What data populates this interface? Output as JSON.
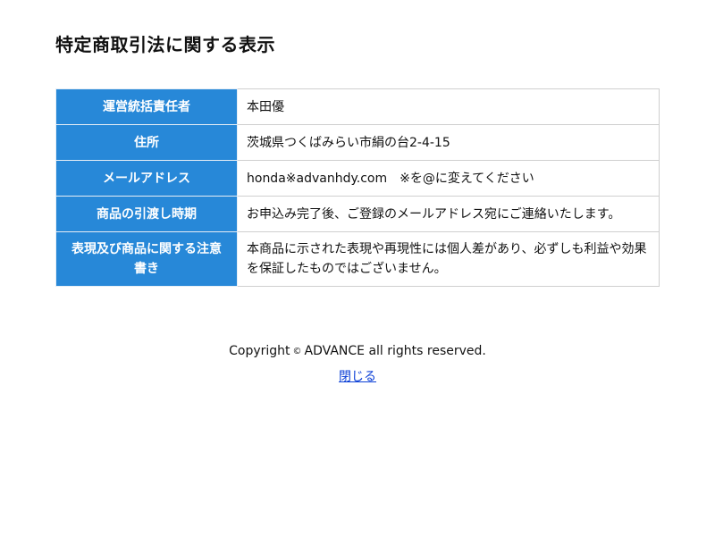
{
  "page": {
    "title": "特定商取引法に関する表示"
  },
  "table": {
    "rows": [
      {
        "label": "運営統括責任者",
        "value": "本田優"
      },
      {
        "label": "住所",
        "value": "茨城県つくばみらい市絹の台2-4-15"
      },
      {
        "label": "メールアドレス",
        "value": "honda※advanhdy.com　※を@に変えてください"
      },
      {
        "label": "商品の引渡し時期",
        "value": "お申込み完了後、ご登録のメールアドレス宛にご連絡いたします。"
      },
      {
        "label": "表現及び商品に関する注意書き",
        "value": "本商品に示された表現や再現性には個人差があり、必ずしも利益や効果を保証したものではございません。"
      }
    ]
  },
  "footer": {
    "copyright_prefix": "Copyright",
    "copyright_symbol": "©",
    "copyright_suffix": "ADVANCE all rights reserved.",
    "close_label": "閉じる"
  },
  "colors": {
    "header_cell": "#2788d8",
    "link": "#0b3fd6"
  }
}
